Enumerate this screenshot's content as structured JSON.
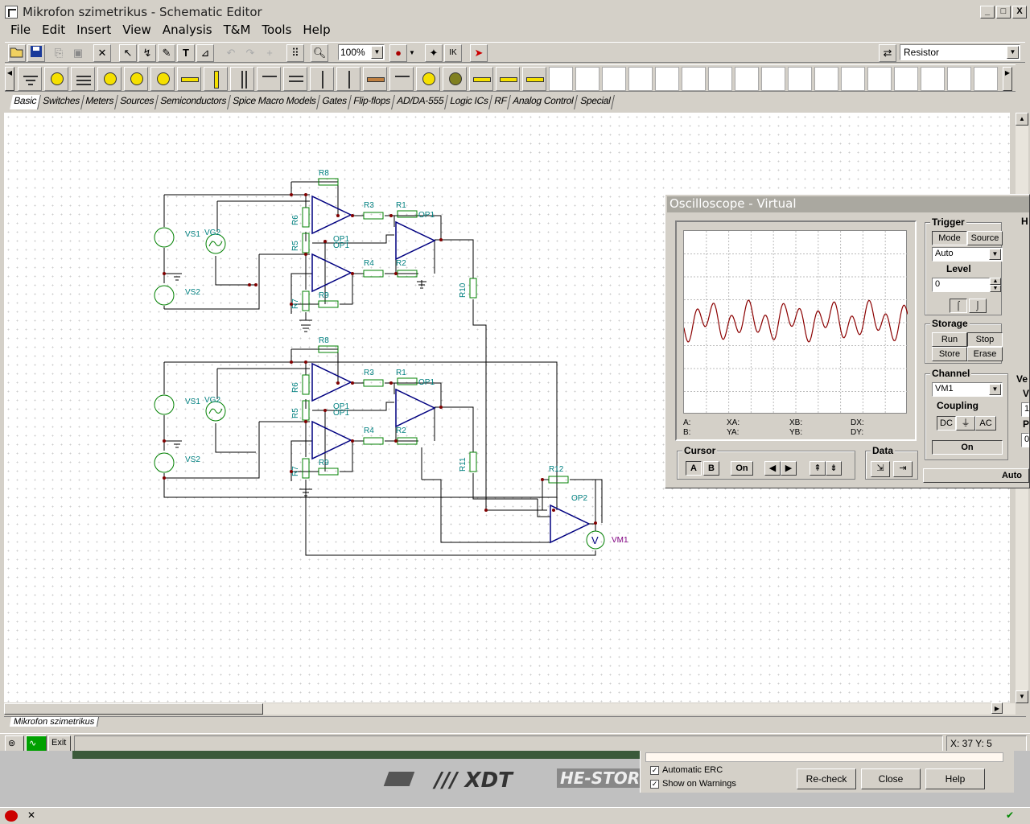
{
  "window": {
    "title": "Mikrofon szimetrikus - Schematic Editor",
    "btn_min": "_",
    "btn_max": "□",
    "btn_close": "X"
  },
  "menu": [
    "File",
    "Edit",
    "Insert",
    "View",
    "Analysis",
    "T&M",
    "Tools",
    "Help"
  ],
  "toolbar": {
    "zoom": "100%",
    "component": "Resistor"
  },
  "component_tabs": [
    "Basic",
    "Switches",
    "Meters",
    "Sources",
    "Semiconductors",
    "Spice Macro Models",
    "Gates",
    "Flip-flops",
    "AD/DA-555",
    "Logic ICs",
    "RF",
    "Analog Control",
    "Special"
  ],
  "schematic": {
    "labels": {
      "r8": "R8",
      "r3": "R3",
      "r1": "R1",
      "op1": "OP1",
      "r6": "R6",
      "r5": "R5",
      "op1b": "OP1",
      "op1c": "OP1",
      "r4": "R4",
      "r2": "R2",
      "r7": "R7",
      "r9": "R9",
      "vs1": "VS1",
      "vg2": "VG2",
      "vs2": "VS2",
      "r10": "R10",
      "r11": "R11",
      "r12": "R12",
      "op2": "OP2",
      "vm1": "VM1",
      "v": "V"
    }
  },
  "document_tab": "Mikrofon szimetrikus",
  "status": {
    "exit": "Exit",
    "coords": "X: 37 Y: 5"
  },
  "erc": {
    "automatic": "Automatic ERC",
    "warnings": "Show on Warnings",
    "recheck": "Re-check",
    "close": "Close",
    "help": "Help"
  },
  "logos": {
    "xdt": "/// XDT",
    "estore": "HE-STORE"
  },
  "oscilloscope": {
    "title": "Oscilloscope - Virtual",
    "trigger": {
      "label": "Trigger",
      "mode": "Mode",
      "source": "Source",
      "mode_value": "Auto",
      "level_label": "Level",
      "level_value": "0"
    },
    "storage": {
      "label": "Storage",
      "run": "Run",
      "stop": "Stop",
      "store": "Store",
      "erase": "Erase"
    },
    "channel": {
      "label": "Channel",
      "value": "VM1",
      "coupling_label": "Coupling",
      "dc": "DC",
      "ac": "AC",
      "on": "On"
    },
    "cursor": {
      "label": "Cursor",
      "a": "A",
      "b": "B",
      "on": "On"
    },
    "data": {
      "label": "Data"
    },
    "auto": "Auto",
    "readouts": {
      "a": "A:",
      "b": "B:",
      "xa": "XA:",
      "ya": "YA:",
      "xb": "XB:",
      "yb": "YB:",
      "dx": "DX:",
      "dy": "DY:"
    },
    "partial": {
      "h": "H",
      "ve": "Ve",
      "v": "V",
      "p": "P",
      "one": "1",
      "zero": "0"
    }
  },
  "colors": {
    "wire": "#000000",
    "part": "#008000",
    "label": "#008080",
    "opamp": "#000080",
    "meter": "#800080",
    "trace": "#8b0000"
  }
}
